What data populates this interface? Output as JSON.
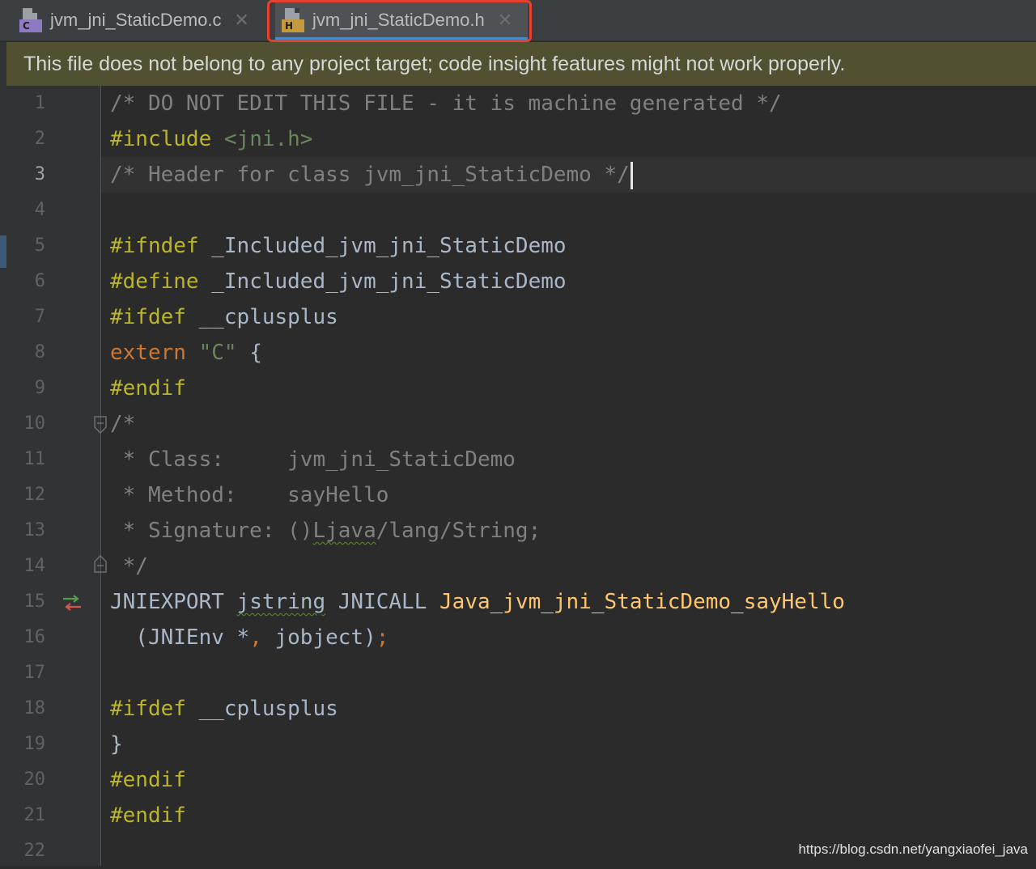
{
  "tabs": [
    {
      "label": "jvm_jni_StaticDemo.c",
      "badge": "C",
      "icon": "c-source-file-icon",
      "close": "✕"
    },
    {
      "label": "jvm_jni_StaticDemo.h",
      "badge": "H",
      "icon": "header-file-icon",
      "close": "✕",
      "active": true
    }
  ],
  "banner": {
    "text": "This file does not belong to any project target; code insight features might not work properly."
  },
  "editor": {
    "current_line": 3,
    "lines": [
      {
        "n": "1"
      },
      {
        "n": "2"
      },
      {
        "n": "3"
      },
      {
        "n": "4"
      },
      {
        "n": "5"
      },
      {
        "n": "6"
      },
      {
        "n": "7"
      },
      {
        "n": "8"
      },
      {
        "n": "9"
      },
      {
        "n": "10"
      },
      {
        "n": "11"
      },
      {
        "n": "12"
      },
      {
        "n": "13"
      },
      {
        "n": "14"
      },
      {
        "n": "15"
      },
      {
        "n": "16"
      },
      {
        "n": "17"
      },
      {
        "n": "18"
      },
      {
        "n": "19"
      },
      {
        "n": "20"
      },
      {
        "n": "21"
      },
      {
        "n": "22"
      }
    ],
    "code": {
      "l1": "/* DO NOT EDIT THIS FILE - it is machine generated */",
      "l2_pp": "#include ",
      "l2_str": "<jni.h>",
      "l3": "/* Header for class jvm_jni_StaticDemo */",
      "l5_pp": "#ifndef ",
      "l5_id": "_Included_jvm_jni_StaticDemo",
      "l6_pp": "#define ",
      "l6_id": "_Included_jvm_jni_StaticDemo",
      "l7_pp": "#ifdef ",
      "l7_id": "__cplusplus",
      "l8_kw": "extern ",
      "l8_str": "\"C\"",
      "l8_rest": " {",
      "l9_pp": "#endif",
      "l10": "/*",
      "l11": " * Class:     jvm_jni_StaticDemo",
      "l12": " * Method:    sayHello",
      "l13_a": " * Signature: ()",
      "l13_b": "Ljava",
      "l13_c": "/lang/String;",
      "l14": " */",
      "l15_a": "JNIEXPORT ",
      "l15_b": "jstring",
      "l15_c": " JNICALL ",
      "l15_fn": "Java_jvm_jni_StaticDemo_sayHello",
      "l16_a": "  (JNIEnv *",
      "l16_comma": ",",
      "l16_b": " jobject)",
      "l16_semi": ";",
      "l18_pp": "#ifdef ",
      "l18_id": "__cplusplus",
      "l19": "}",
      "l20_pp": "#endif",
      "l21_pp": "#endif"
    }
  },
  "watermark": "https://blog.csdn.net/yangxiaofei_java",
  "colors": {
    "tab_highlight_border": "#e8402e",
    "banner_bg": "#515131",
    "editor_bg": "#2b2b2b"
  }
}
